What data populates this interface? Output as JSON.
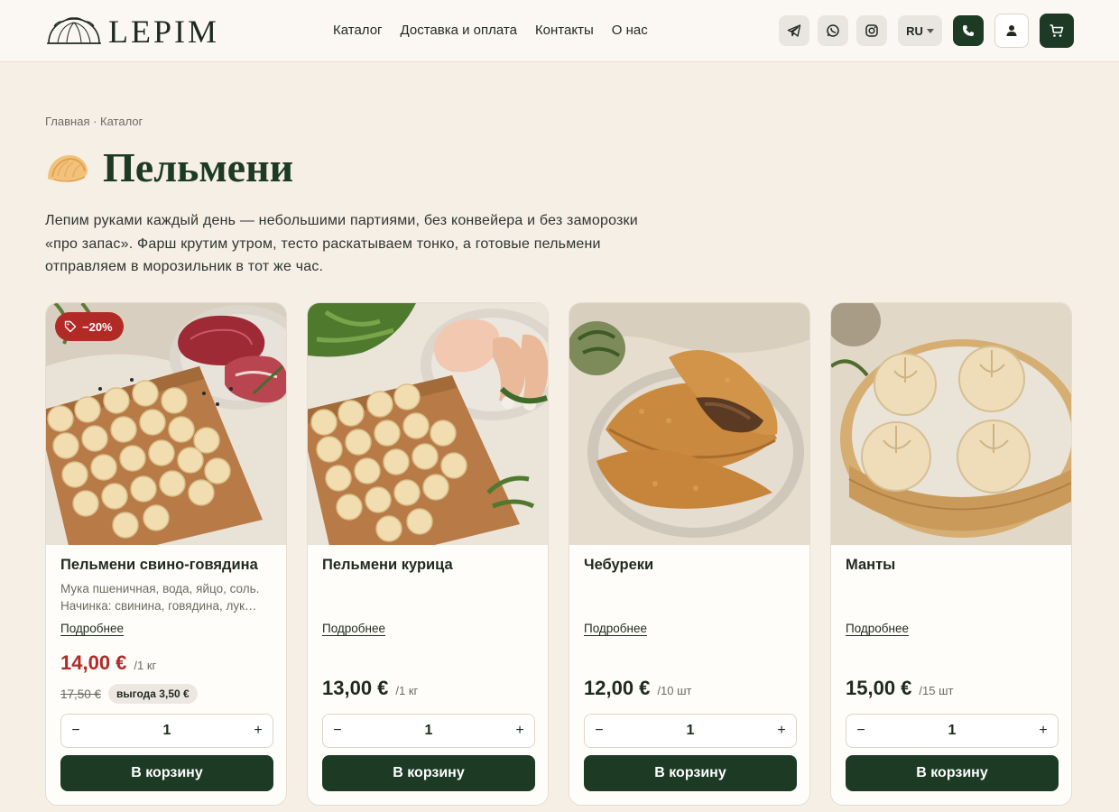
{
  "header": {
    "brand": "LEPIM",
    "nav": [
      "Каталог",
      "Доставка и оплата",
      "Контакты",
      "О нас"
    ],
    "lang": "RU",
    "icons": [
      "telegram-icon",
      "whatsapp-icon",
      "instagram-icon",
      "phone-icon",
      "user-icon",
      "cart-icon"
    ]
  },
  "breadcrumb": "Главная · Каталог",
  "page_title": "Пельмени",
  "intro": "Лепим руками каждый день — небольшими партиями, без конвейера и без заморозки «про запас». Фарш крутим утром, тесто раскатываем тонко, а готовые пельмени отправляем в морозильник в тот же час.",
  "colors": {
    "accent": "#1c3a24",
    "sale": "#b22a26",
    "background": "#f5efe6"
  },
  "products": [
    {
      "name": "Пельмени свино-говядина",
      "desc_line1": "Мука пшеничная, вода, яйцо, соль.",
      "desc_line2": "Начинка: свинина, говядина, лук…",
      "more": "Подробнее",
      "badge": "−20%",
      "price": "14,00 €",
      "unit": "/1 кг",
      "old_price": "17,50 €",
      "savings": "выгода 3,50 €",
      "qty": "1",
      "add": "В корзину"
    },
    {
      "name": "Пельмени курица",
      "more": "Подробнее",
      "price": "13,00 €",
      "unit": "/1 кг",
      "qty": "1",
      "add": "В корзину"
    },
    {
      "name": "Чебуреки",
      "more": "Подробнее",
      "price": "12,00 €",
      "unit": "/10 шт",
      "qty": "1",
      "add": "В корзину"
    },
    {
      "name": "Манты",
      "more": "Подробнее",
      "price": "15,00 €",
      "unit": "/15 шт",
      "qty": "1",
      "add": "В корзину"
    }
  ]
}
